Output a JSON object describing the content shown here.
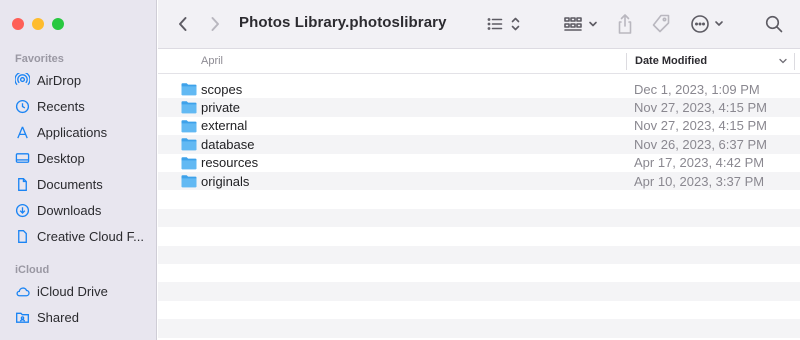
{
  "window": {
    "title": "Photos Library.photoslibrary"
  },
  "sidebar": {
    "favorites_title": "Favorites",
    "favorites": [
      {
        "label": "AirDrop",
        "icon": "airdrop-icon"
      },
      {
        "label": "Recents",
        "icon": "clock-icon"
      },
      {
        "label": "Applications",
        "icon": "applications-icon"
      },
      {
        "label": "Desktop",
        "icon": "desktop-icon"
      },
      {
        "label": "Documents",
        "icon": "document-icon"
      },
      {
        "label": "Downloads",
        "icon": "download-icon"
      },
      {
        "label": "Creative Cloud F...",
        "icon": "file-icon"
      }
    ],
    "icloud_title": "iCloud",
    "icloud": [
      {
        "label": "iCloud Drive",
        "icon": "cloud-icon"
      },
      {
        "label": "Shared",
        "icon": "shared-folder-icon"
      }
    ]
  },
  "columns": {
    "name": "April",
    "date": "Date Modified"
  },
  "files": [
    {
      "name": "scopes",
      "date": "Dec 1, 2023, 1:09 PM"
    },
    {
      "name": "private",
      "date": "Nov 27, 2023, 4:15 PM"
    },
    {
      "name": "external",
      "date": "Nov 27, 2023, 4:15 PM"
    },
    {
      "name": "database",
      "date": "Nov 26, 2023, 6:37 PM"
    },
    {
      "name": "resources",
      "date": "Apr 17, 2023, 4:42 PM"
    },
    {
      "name": "originals",
      "date": "Apr 10, 2023, 3:37 PM"
    }
  ],
  "colors": {
    "accent": "#1a84f4",
    "folder": "#5bb4f0",
    "sidebar_bg": "#e8e6ef"
  }
}
